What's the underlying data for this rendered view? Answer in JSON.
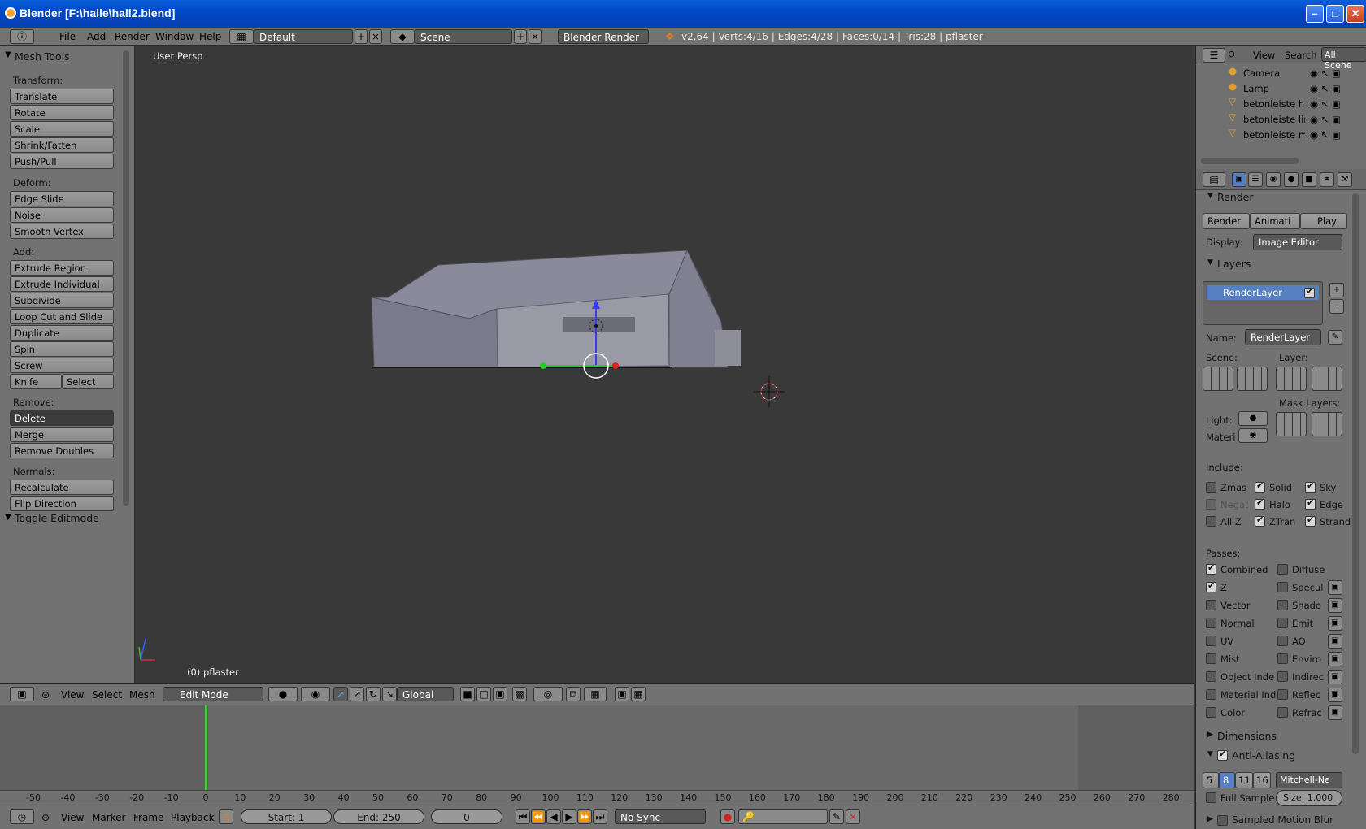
{
  "window": {
    "title": "Blender [F:\\halle\\hall2.blend]"
  },
  "menubar": {
    "menus": [
      "File",
      "Add",
      "Render",
      "Window",
      "Help"
    ],
    "layout": "Default",
    "scene": "Scene",
    "engine": "Blender Render",
    "stats": "v2.64 | Verts:4/16 | Edges:4/28 | Faces:0/14 | Tris:28 | pflaster"
  },
  "toolshelf": {
    "title": "Mesh Tools",
    "transform_label": "Transform:",
    "transform": [
      "Translate",
      "Rotate",
      "Scale",
      "Shrink/Fatten",
      "Push/Pull"
    ],
    "deform_label": "Deform:",
    "deform": [
      "Edge Slide",
      "Noise",
      "Smooth Vertex"
    ],
    "add_label": "Add:",
    "add": [
      "Extrude Region",
      "Extrude Individual",
      "Subdivide",
      "Loop Cut and Slide",
      "Duplicate",
      "Spin",
      "Screw"
    ],
    "knife": "Knife",
    "select": "Select",
    "remove_label": "Remove:",
    "delete": "Delete",
    "remove": [
      "Merge",
      "Remove Doubles"
    ],
    "normals_label": "Normals:",
    "normals": [
      "Recalculate",
      "Flip Direction"
    ],
    "toggle_editmode": "Toggle Editmode"
  },
  "viewport": {
    "view_name": "User Persp",
    "object_label": "(0) pflaster"
  },
  "outliner": {
    "view": "View",
    "search": "Search",
    "scenes": "All Scene",
    "items": [
      "Camera",
      "Lamp",
      "betonleiste hin",
      "betonleiste lin",
      "betonleiste mi"
    ]
  },
  "properties": {
    "render_panel": "Render",
    "render_btn": "Render",
    "anim_btn": "Animati",
    "play_btn": "Play",
    "display_label": "Display:",
    "display_value": "Image Editor",
    "layers_panel": "Layers",
    "render_layer": "RenderLayer",
    "name_label": "Name:",
    "name_value": "RenderLayer",
    "scene_label": "Scene:",
    "layer_label": "Layer:",
    "mask_layers_label": "Mask Layers:",
    "light_label": "Light:",
    "materi_label": "Materi",
    "include_label": "Include:",
    "include": [
      "Zmas",
      "Solid",
      "Sky",
      "Negat",
      "Halo",
      "Edge",
      "All Z",
      "ZTran",
      "Strand"
    ],
    "passes_label": "Passes:",
    "passes_left": [
      "Combined",
      "Z",
      "Vector",
      "Normal",
      "UV",
      "Mist",
      "Object Inde",
      "Material Ind",
      "Color"
    ],
    "passes_right": [
      "Diffuse",
      "Specul",
      "Shado",
      "Emit",
      "AO",
      "Enviro",
      "Indirec",
      "Reflec",
      "Refrac"
    ],
    "dimensions_panel": "Dimensions",
    "aa_panel": "Anti-Aliasing",
    "aa_samples": [
      "5",
      "8",
      "11",
      "16"
    ],
    "aa_filter": "Mitchell-Ne",
    "full_sample": "Full Sample",
    "size": "Size: 1.000",
    "motion_blur": "Sampled Motion Blur"
  },
  "v3dheader": {
    "menus": [
      "View",
      "Select",
      "Mesh"
    ],
    "mode": "Edit Mode",
    "orientation": "Global"
  },
  "timeline": {
    "ruler": [
      "-50",
      "-40",
      "-30",
      "-20",
      "-10",
      "0",
      "10",
      "20",
      "30",
      "40",
      "50",
      "60",
      "70",
      "80",
      "90",
      "100",
      "110",
      "120",
      "130",
      "140",
      "150",
      "160",
      "170",
      "180",
      "190",
      "200",
      "210",
      "220",
      "230",
      "240",
      "250",
      "260",
      "270",
      "280"
    ],
    "menus": [
      "View",
      "Marker",
      "Frame",
      "Playback"
    ],
    "start": "Start: 1",
    "end": "End: 250",
    "current": "0",
    "sync": "No Sync"
  },
  "colors": {
    "accent": "#5680c2",
    "frame_marker": "#4cc83c"
  }
}
